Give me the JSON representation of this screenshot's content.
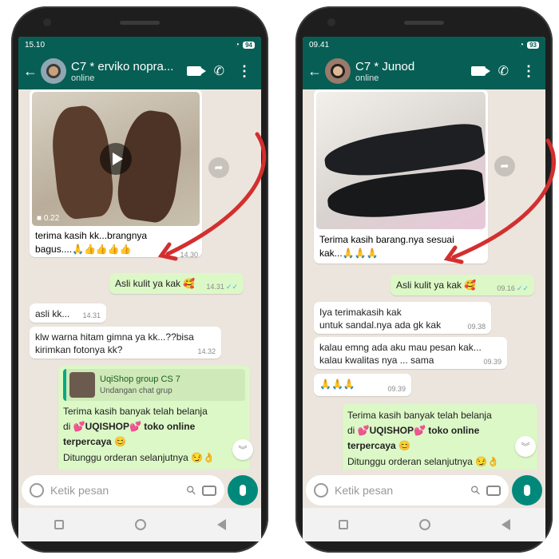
{
  "left": {
    "status_time": "15.10",
    "battery": "94",
    "contact_name": "C7 * erviko nopra...",
    "contact_status": "online",
    "video_duration": "0.22",
    "msg1": {
      "line1": "terima kasih kk...brangnya",
      "line2": "bagus....🙏👍👍👍👍",
      "time": "14.30"
    },
    "msg2": {
      "text": "Asli kulit ya kak 🥰",
      "time": "14.31"
    },
    "msg3": {
      "text": "asli kk...",
      "time": "14.31"
    },
    "msg4": {
      "line1": "klw warna hitam gimna ya kk...??bisa",
      "line2": "kirimkan fotonya kk?",
      "time": "14.32"
    },
    "quote_title": "UqiShop group CS 7",
    "quote_sub": "Undangan chat grup",
    "promo": {
      "line1": "Terima kasih banyak telah belanja",
      "line2_pre": "di 💕",
      "brand": "UQISHOP",
      "line2_post": "💕 toko online",
      "line3": "terpercaya 😊",
      "line4": "Ditunggu orderan selanjutnya 😏👌"
    },
    "input_placeholder": "Ketik pesan"
  },
  "right": {
    "status_time": "09.41",
    "battery": "93",
    "contact_name": "C7 * Junod",
    "contact_status": "online",
    "msg1": {
      "line1": "Terima kasih barang.nya sesuai",
      "line2": "kak...🙏🙏🙏"
    },
    "msg2": {
      "text": "Asli kulit ya kak 🥰",
      "time": "09.16"
    },
    "msg3": {
      "line1": "Iya terimakasih kak",
      "line2": "untuk sandal.nya ada gk kak",
      "time": "09.38"
    },
    "msg4": {
      "line1": "kalau emng ada aku mau pesan kak...",
      "line2": "kalau kwalitas nya ... sama",
      "time": "09.39"
    },
    "msg5": {
      "text": "🙏🙏🙏",
      "time": "09.39"
    },
    "promo": {
      "line1": "Terima kasih banyak telah belanja",
      "line2_pre": "di 💕",
      "brand": "UQISHOP",
      "line2_post": "💕 toko online",
      "line3": "terpercaya 😊",
      "line4": "Ditunggu orderan selanjutnya 😏👌"
    },
    "input_placeholder": "Ketik pesan"
  },
  "colors": {
    "header": "#075e54",
    "outgoing": "#dcf8c6",
    "chat_bg": "#ece5dd",
    "arrow": "#d32f2f",
    "mic": "#00897b"
  }
}
